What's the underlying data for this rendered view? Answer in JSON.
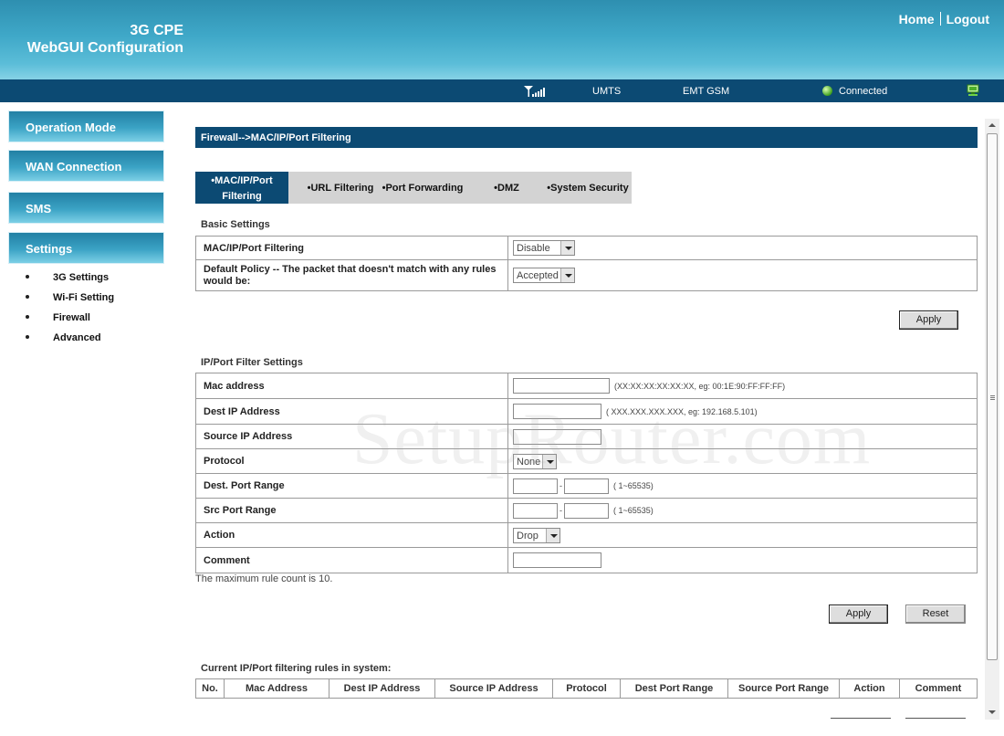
{
  "header": {
    "brand_line1": "3G CPE",
    "brand_line2": "WebGUI Configuration",
    "home_link": "Home",
    "logout_link": "Logout",
    "gradient_color": "#3fa8c8"
  },
  "statusbar": {
    "signal_icon": "signal-strength-icon",
    "network_mode": "UMTS",
    "operator": "EMT GSM",
    "connection_status": "Connected",
    "connection_icon": "status-green-icon",
    "computer_icon": "computer-icon",
    "bar_color": "#0c4a73"
  },
  "sidebar": {
    "menu": [
      {
        "label": "Operation Mode"
      },
      {
        "label": "WAN Connection"
      },
      {
        "label": "SMS"
      },
      {
        "label": "Settings"
      }
    ],
    "submenu": [
      {
        "label": "3G Settings"
      },
      {
        "label": "Wi-Fi Setting"
      },
      {
        "label": "Firewall"
      },
      {
        "label": "Advanced"
      }
    ]
  },
  "breadcrumb": "Firewall-->MAC/IP/Port Filtering",
  "tabs": [
    {
      "label_line1": "•MAC/IP/Port",
      "label_line2": "Filtering",
      "active": true
    },
    {
      "label": "•URL Filtering"
    },
    {
      "label": "•Port Forwarding"
    },
    {
      "label": "•DMZ"
    },
    {
      "label": "•System Security"
    }
  ],
  "basic_settings": {
    "title": "Basic Settings",
    "rows": [
      {
        "label": "MAC/IP/Port Filtering",
        "value": "Disable"
      },
      {
        "label_line1": "Default Policy -- The packet that doesn't match with any rules",
        "label_line2": "would be:",
        "value": "Accepted"
      }
    ],
    "apply_label": "Apply"
  },
  "filter_settings": {
    "title": "IP/Port Filter Settings",
    "mac_label": "Mac address",
    "mac_hint": "(XX:XX:XX:XX:XX:XX,  eg: 00:1E:90:FF:FF:FF)",
    "dest_ip_label": "Dest IP Address",
    "dest_ip_hint": "( XXX.XXX.XXX.XXX, eg: 192.168.5.101)",
    "source_ip_label": "Source IP Address",
    "protocol_label": "Protocol",
    "protocol_value": "None",
    "dest_port_label": "Dest. Port Range",
    "src_port_label": "Src Port Range",
    "port_dash": "-",
    "port_hint": "( 1~65535)",
    "action_label": "Action",
    "action_value": "Drop",
    "comment_label": "Comment",
    "max_rule_note": "The maximum rule count is 10.",
    "apply_label": "Apply",
    "reset_label": "Reset"
  },
  "rules_table": {
    "title": "Current IP/Port filtering rules in system:",
    "columns": [
      "No.",
      "Mac Address",
      "Dest IP Address",
      "Source IP Address",
      "Protocol",
      "Dest Port Range",
      "Source Port Range",
      "Action",
      "Comment"
    ]
  },
  "watermark": "SetupRouter.com"
}
